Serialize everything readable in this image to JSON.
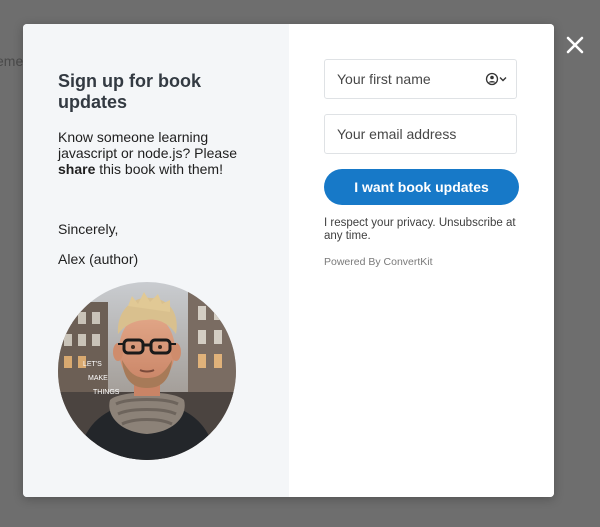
{
  "background": {
    "partial_text": "eme"
  },
  "modal": {
    "heading": "Sign up for book updates",
    "description": {
      "part1": "Know someone learning javascript or node.js? Please ",
      "bold": "share",
      "part2": " this book with them!"
    },
    "sincerely": "Sincerely,",
    "author": "Alex (author)",
    "avatar": {
      "sign_lines": [
        "LET'S",
        "MAKE",
        "THINGS"
      ]
    },
    "form": {
      "first_name_placeholder": "Your first name",
      "email_placeholder": "Your email address",
      "submit_label": "I want book updates",
      "privacy": "I respect your privacy. Unsubscribe at any time.",
      "powered_by": "Powered By ConvertKit"
    }
  },
  "icons": {
    "close": "close-icon",
    "autofill": "contact-autofill-icon"
  },
  "colors": {
    "overlay": "#6e6e6e",
    "panel_left": "#f4f6f8",
    "button": "#1779c8",
    "heading": "#333a42"
  }
}
